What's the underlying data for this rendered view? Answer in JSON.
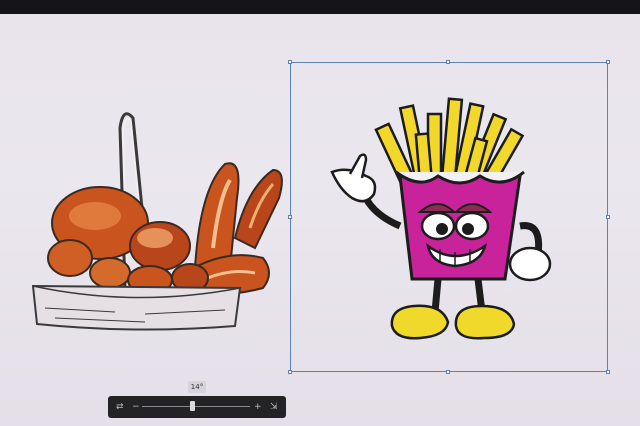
{
  "canvas": {
    "rotation_readout": "14°",
    "artwork": [
      {
        "name": "bread-basket-illustration"
      },
      {
        "name": "fries-character-illustration",
        "selected": true
      }
    ]
  },
  "zoom_controls": {
    "swap_icon": "swap-arrows-icon",
    "minus_glyph": "−",
    "plus_glyph": "+",
    "fit_icon": "fit-to-screen-icon",
    "slider_level": 0.45
  },
  "colors": {
    "canvas_background": "#e9e4ec",
    "selection": "#5c82b8",
    "fries_box": "#c8239a",
    "fries": "#f2d82b",
    "shoes": "#f0d92a",
    "bread": "#c9541d"
  }
}
